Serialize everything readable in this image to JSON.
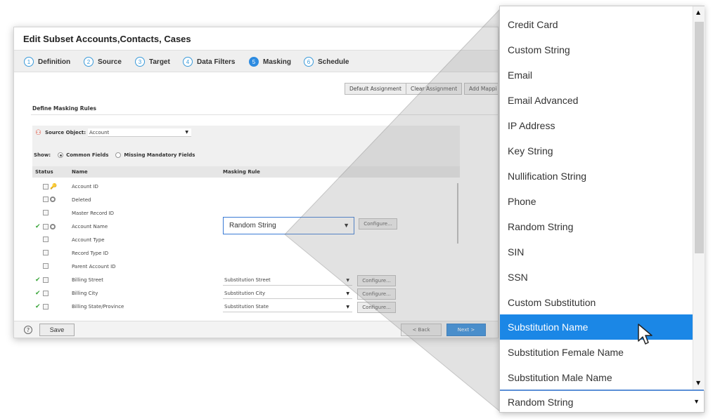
{
  "dialog": {
    "title": "Edit Subset Accounts,Contacts, Cases",
    "steps": [
      {
        "num": "1",
        "label": "Definition"
      },
      {
        "num": "2",
        "label": "Source"
      },
      {
        "num": "3",
        "label": "Target"
      },
      {
        "num": "4",
        "label": "Data Filters"
      },
      {
        "num": "5",
        "label": "Masking",
        "active": true
      },
      {
        "num": "6",
        "label": "Schedule"
      }
    ],
    "toolbar": {
      "default_assignment": "Default Assignment",
      "clear_assignment": "Clear Assignment",
      "add_mapping": "Add Mappi"
    },
    "section_title": "Define Masking Rules",
    "source_object_label": "Source Object:",
    "source_object_value": "Account",
    "show_label": "Show:",
    "show_common": "Common Fields",
    "show_missing": "Missing Mandatory Fields",
    "columns": {
      "status": "Status",
      "name": "Name",
      "rule": "Masking Rule"
    },
    "rows": [
      {
        "name": "Account ID"
      },
      {
        "name": "Deleted"
      },
      {
        "name": "Master Record ID"
      },
      {
        "name": "Account Name",
        "rule": "Random String",
        "configure": "Configure..."
      },
      {
        "name": "Account Type"
      },
      {
        "name": "Record Type ID"
      },
      {
        "name": "Parent Account ID"
      },
      {
        "name": "Billing Street",
        "rule": "Substitution Street",
        "configure": "Configure..."
      },
      {
        "name": "Billing City",
        "rule": "Substitution City",
        "configure": "Configure..."
      },
      {
        "name": "Billing State/Province",
        "rule": "Substitution State",
        "configure": "Configure..."
      }
    ],
    "footer": {
      "help": "?",
      "save": "Save",
      "back": "< Back",
      "next": "Next >"
    }
  },
  "dropdown": {
    "options": [
      "Credit Card",
      "Custom String",
      "Email",
      "Email Advanced",
      "IP Address",
      "Key String",
      "Nullification String",
      "Phone",
      "Random String",
      "SIN",
      "SSN",
      "Custom Substitution",
      "Substitution Name",
      "Substitution Female Name",
      "Substitution Male Name"
    ],
    "selected_index": 12,
    "current_value": "Random String"
  },
  "colors": {
    "accent": "#2d8be0",
    "selected_option": "#1b87e6",
    "check": "#3aa63a",
    "source_icon": "#e0402c"
  }
}
